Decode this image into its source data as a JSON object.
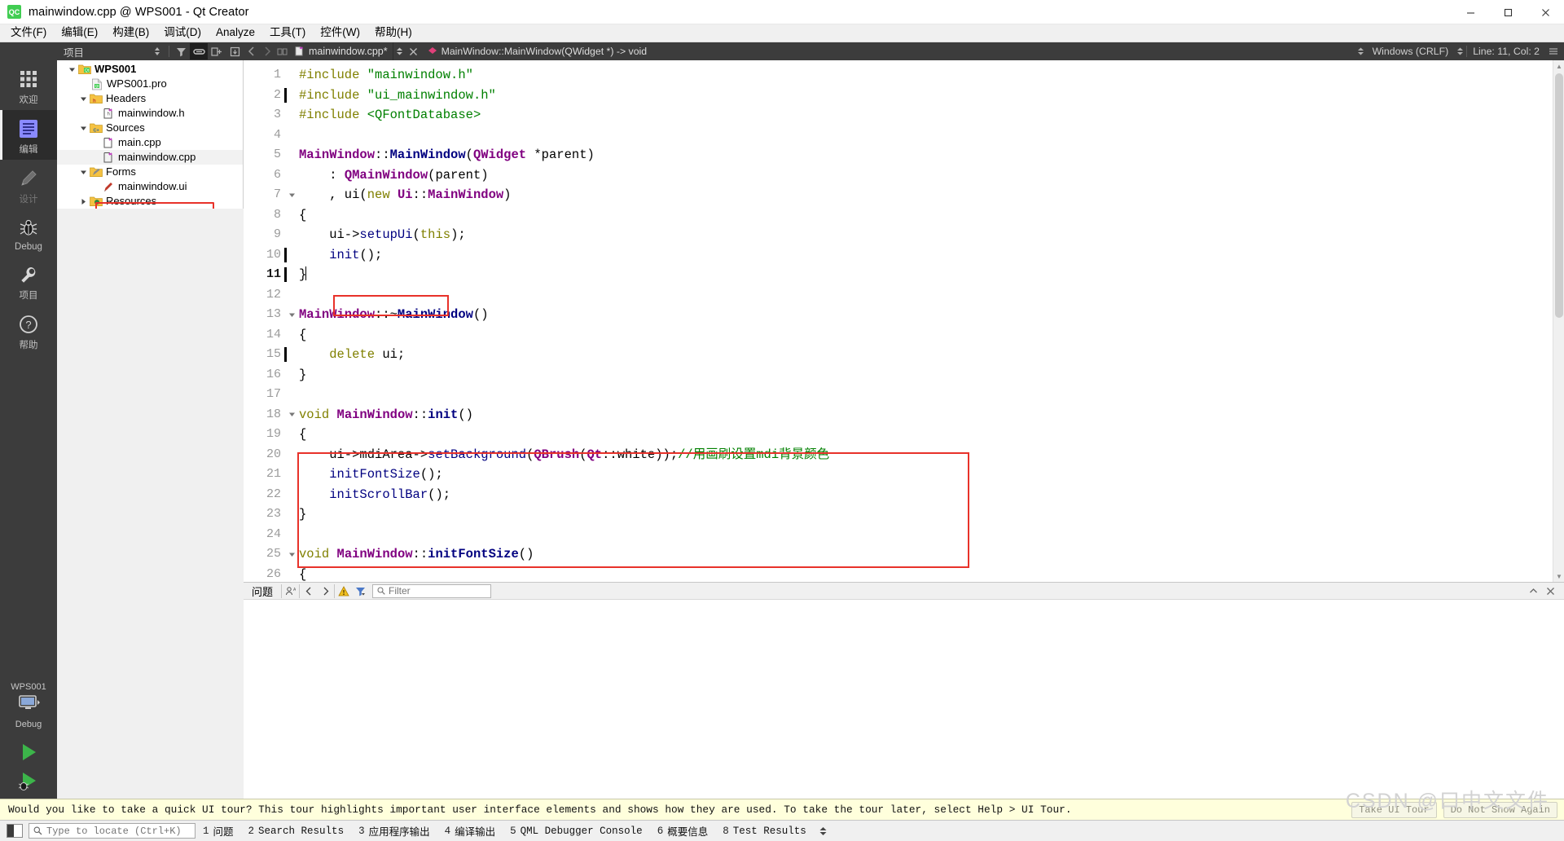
{
  "window": {
    "title": "mainwindow.cpp @ WPS001 - Qt Creator",
    "app_badge": "QC",
    "minimize_label": "—",
    "maximize_label": "☐",
    "close_label": "✕"
  },
  "menubar": {
    "items": [
      {
        "label": "文件(F)",
        "name": "menu-file"
      },
      {
        "label": "编辑(E)",
        "name": "menu-edit"
      },
      {
        "label": "构建(B)",
        "name": "menu-build"
      },
      {
        "label": "调试(D)",
        "name": "menu-debug"
      },
      {
        "label": "Analyze",
        "name": "menu-analyze"
      },
      {
        "label": "工具(T)",
        "name": "menu-tools"
      },
      {
        "label": "控件(W)",
        "name": "menu-window"
      },
      {
        "label": "帮助(H)",
        "name": "menu-help"
      }
    ]
  },
  "sidebar": {
    "pane_title": "项目",
    "modes": [
      {
        "label": "欢迎",
        "icon": "grid-icon",
        "state": "normal"
      },
      {
        "label": "编辑",
        "icon": "edit-lines-icon",
        "state": "selected"
      },
      {
        "label": "设计",
        "icon": "pencil-icon",
        "state": "disabled"
      },
      {
        "label": "Debug",
        "icon": "bug-icon",
        "state": "normal"
      },
      {
        "label": "项目",
        "icon": "wrench-icon",
        "state": "normal"
      },
      {
        "label": "帮助",
        "icon": "question-icon",
        "state": "normal"
      }
    ],
    "kit": {
      "project": "WPS001",
      "build_config": "Debug",
      "monitor_icon": "desktop-icon"
    },
    "run_buttons": [
      {
        "name": "run-button",
        "icon": "play-icon"
      },
      {
        "name": "debug-run-button",
        "icon": "play-bug-icon"
      }
    ]
  },
  "project_tree": {
    "nodes": [
      {
        "label": "WPS001",
        "depth": 0,
        "icon": "qt-folder-icon",
        "arrow": "down",
        "bold": true,
        "selected": false
      },
      {
        "label": "WPS001.pro",
        "depth": 1,
        "icon": "qt-file-icon",
        "arrow": "none",
        "bold": false,
        "selected": false
      },
      {
        "label": "Headers",
        "depth": 1,
        "icon": "folder-h-icon",
        "arrow": "down",
        "bold": false,
        "selected": false
      },
      {
        "label": "mainwindow.h",
        "depth": 2,
        "icon": "header-file-icon",
        "arrow": "none",
        "bold": false,
        "selected": false
      },
      {
        "label": "Sources",
        "depth": 1,
        "icon": "folder-cpp-icon",
        "arrow": "down",
        "bold": false,
        "selected": false
      },
      {
        "label": "main.cpp",
        "depth": 2,
        "icon": "cpp-file-icon",
        "arrow": "none",
        "bold": false,
        "selected": false
      },
      {
        "label": "mainwindow.cpp",
        "depth": 2,
        "icon": "cpp-file-icon",
        "arrow": "none",
        "bold": false,
        "selected": true
      },
      {
        "label": "Forms",
        "depth": 1,
        "icon": "folder-ui-icon",
        "arrow": "down",
        "bold": false,
        "selected": false
      },
      {
        "label": "mainwindow.ui",
        "depth": 2,
        "icon": "ui-file-icon",
        "arrow": "none",
        "bold": false,
        "selected": false
      },
      {
        "label": "Resources",
        "depth": 1,
        "icon": "folder-res-icon",
        "arrow": "right",
        "bold": false,
        "selected": false
      }
    ],
    "highlight_color": "#e8322a"
  },
  "editor": {
    "tab": {
      "label": "mainwindow.cpp*",
      "icon": "cpp-file-icon",
      "close_icon": "close-icon"
    },
    "symbol": "MainWindow::MainWindow(QWidget *) -> void",
    "symbol_icon": "function-diamond-icon",
    "status": {
      "line_ending": "Windows (CRLF)",
      "cursor": "Line: 11, Col: 2"
    },
    "lines": [
      {
        "n": 1,
        "fold": "none",
        "current": false,
        "tokens": [
          {
            "t": "#include ",
            "c": "pp"
          },
          {
            "t": "\"mainwindow.h\"",
            "c": "str"
          }
        ]
      },
      {
        "n": 2,
        "fold": "none",
        "current": false,
        "tokens": [
          {
            "t": "#include ",
            "c": "pp"
          },
          {
            "t": "\"ui_mainwindow.h\"",
            "c": "str"
          }
        ]
      },
      {
        "n": 3,
        "fold": "none",
        "current": false,
        "tokens": [
          {
            "t": "#include ",
            "c": "pp"
          },
          {
            "t": "<QFontDatabase>",
            "c": "str"
          }
        ]
      },
      {
        "n": 4,
        "fold": "none",
        "current": false,
        "tokens": []
      },
      {
        "n": 5,
        "fold": "none",
        "current": false,
        "tokens": [
          {
            "t": "MainWindow",
            "c": "ty"
          },
          {
            "t": "::",
            "c": "op"
          },
          {
            "t": "MainWindow",
            "c": "fn"
          },
          {
            "t": "(",
            "c": "op"
          },
          {
            "t": "QWidget",
            "c": "ty"
          },
          {
            "t": " *parent)",
            "c": "op"
          }
        ]
      },
      {
        "n": 6,
        "fold": "none",
        "current": false,
        "tokens": [
          {
            "t": "    : ",
            "c": "op"
          },
          {
            "t": "QMainWindow",
            "c": "ty"
          },
          {
            "t": "(parent)",
            "c": "op"
          }
        ]
      },
      {
        "n": 7,
        "fold": "down",
        "current": false,
        "tokens": [
          {
            "t": "    , ui(",
            "c": "op"
          },
          {
            "t": "new",
            "c": "k"
          },
          {
            "t": " ",
            "c": "op"
          },
          {
            "t": "Ui",
            "c": "ty"
          },
          {
            "t": "::",
            "c": "op"
          },
          {
            "t": "MainWindow",
            "c": "ty"
          },
          {
            "t": ")",
            "c": "op"
          }
        ]
      },
      {
        "n": 8,
        "fold": "none",
        "current": false,
        "tokens": [
          {
            "t": "{",
            "c": "op"
          }
        ]
      },
      {
        "n": 9,
        "fold": "none",
        "current": false,
        "tokens": [
          {
            "t": "    ui->",
            "c": "op"
          },
          {
            "t": "setupUi",
            "c": "fn2"
          },
          {
            "t": "(",
            "c": "op"
          },
          {
            "t": "this",
            "c": "k"
          },
          {
            "t": ");",
            "c": "op"
          }
        ]
      },
      {
        "n": 10,
        "fold": "none",
        "current": false,
        "tokens": [
          {
            "t": "    ",
            "c": "op"
          },
          {
            "t": "init",
            "c": "fn2"
          },
          {
            "t": "();",
            "c": "op"
          }
        ]
      },
      {
        "n": 11,
        "fold": "none",
        "current": true,
        "tokens": [
          {
            "t": "}",
            "c": "op"
          }
        ]
      },
      {
        "n": 12,
        "fold": "none",
        "current": false,
        "tokens": []
      },
      {
        "n": 13,
        "fold": "down",
        "current": false,
        "tokens": [
          {
            "t": "MainWindow",
            "c": "ty"
          },
          {
            "t": "::~",
            "c": "op"
          },
          {
            "t": "MainWindow",
            "c": "fn"
          },
          {
            "t": "()",
            "c": "op"
          }
        ]
      },
      {
        "n": 14,
        "fold": "none",
        "current": false,
        "tokens": [
          {
            "t": "{",
            "c": "op"
          }
        ]
      },
      {
        "n": 15,
        "fold": "none",
        "current": false,
        "tokens": [
          {
            "t": "    ",
            "c": "op"
          },
          {
            "t": "delete",
            "c": "k"
          },
          {
            "t": " ui;",
            "c": "op"
          }
        ]
      },
      {
        "n": 16,
        "fold": "none",
        "current": false,
        "tokens": [
          {
            "t": "}",
            "c": "op"
          }
        ]
      },
      {
        "n": 17,
        "fold": "none",
        "current": false,
        "tokens": []
      },
      {
        "n": 18,
        "fold": "down",
        "current": false,
        "tokens": [
          {
            "t": "void",
            "c": "k"
          },
          {
            "t": " ",
            "c": "op"
          },
          {
            "t": "MainWindow",
            "c": "ty"
          },
          {
            "t": "::",
            "c": "op"
          },
          {
            "t": "init",
            "c": "fn"
          },
          {
            "t": "()",
            "c": "op"
          }
        ]
      },
      {
        "n": 19,
        "fold": "none",
        "current": false,
        "tokens": [
          {
            "t": "{",
            "c": "op"
          }
        ]
      },
      {
        "n": 20,
        "fold": "none",
        "current": false,
        "tokens": [
          {
            "t": "    ui->mdiArea->",
            "c": "op"
          },
          {
            "t": "setBackground",
            "c": "fn2"
          },
          {
            "t": "(",
            "c": "op"
          },
          {
            "t": "QBrush",
            "c": "ty"
          },
          {
            "t": "(",
            "c": "op"
          },
          {
            "t": "Qt",
            "c": "ty"
          },
          {
            "t": "::white));",
            "c": "op"
          },
          {
            "t": "//用画刷设置mdi背景颜色",
            "c": "cm"
          }
        ]
      },
      {
        "n": 21,
        "fold": "none",
        "current": false,
        "tokens": [
          {
            "t": "    ",
            "c": "op"
          },
          {
            "t": "initFontSize",
            "c": "fn2"
          },
          {
            "t": "();",
            "c": "op"
          }
        ]
      },
      {
        "n": 22,
        "fold": "none",
        "current": false,
        "tokens": [
          {
            "t": "    ",
            "c": "op"
          },
          {
            "t": "initScrollBar",
            "c": "fn2"
          },
          {
            "t": "();",
            "c": "op"
          }
        ]
      },
      {
        "n": 23,
        "fold": "none",
        "current": false,
        "tokens": [
          {
            "t": "}",
            "c": "op"
          }
        ]
      },
      {
        "n": 24,
        "fold": "none",
        "current": false,
        "tokens": []
      },
      {
        "n": 25,
        "fold": "down",
        "current": false,
        "tokens": [
          {
            "t": "void",
            "c": "k"
          },
          {
            "t": " ",
            "c": "op"
          },
          {
            "t": "MainWindow",
            "c": "ty"
          },
          {
            "t": "::",
            "c": "op"
          },
          {
            "t": "initFontSize",
            "c": "fn"
          },
          {
            "t": "()",
            "c": "op"
          }
        ]
      },
      {
        "n": 26,
        "fold": "none",
        "current": false,
        "tokens": [
          {
            "t": "{",
            "c": "op"
          }
        ]
      }
    ]
  },
  "issues_pane": {
    "title": "问题",
    "filter_placeholder": "Filter",
    "filter_value": "",
    "buttons": [
      {
        "name": "toggle-filter-icon",
        "icon": "person-filter-icon"
      },
      {
        "name": "prev-issue-button",
        "icon": "chevron-left-icon"
      },
      {
        "name": "next-issue-button",
        "icon": "chevron-right-icon"
      },
      {
        "name": "warning-filter-button",
        "icon": "warning-triangle-icon"
      },
      {
        "name": "filter-dropdown-button",
        "icon": "funnel-icon"
      }
    ],
    "right_buttons": [
      {
        "name": "maximize-pane-button",
        "icon": "chevron-up-icon"
      },
      {
        "name": "close-pane-button",
        "icon": "close-icon"
      }
    ]
  },
  "tour_banner": {
    "message": "Would you like to take a quick UI tour? This tour highlights important user interface elements and shows how they are used. To take the tour later, select Help > UI Tour.",
    "primary_button": "Take UI Tour",
    "secondary_button": "Do Not Show Again"
  },
  "statusbar": {
    "locator_placeholder": "Type to locate (Ctrl+K)",
    "search_icon": "search-icon",
    "sidebar_toggle_icon": "sidebar-toggle-icon",
    "tabs": [
      {
        "num": "1",
        "label": "问题"
      },
      {
        "num": "2",
        "label": "Search Results"
      },
      {
        "num": "3",
        "label": "应用程序输出"
      },
      {
        "num": "4",
        "label": "编译输出"
      },
      {
        "num": "5",
        "label": "QML Debugger Console"
      },
      {
        "num": "6",
        "label": "概要信息"
      },
      {
        "num": "8",
        "label": "Test Results"
      }
    ]
  },
  "watermark": "CSDN @口中文文件",
  "colors": {
    "accent_red": "#e8322a",
    "dark_chrome": "#3c3c3c",
    "light_chrome": "#f0f0f0",
    "banner_yellow": "#ffffdc",
    "qt_green": "#41cd52"
  }
}
